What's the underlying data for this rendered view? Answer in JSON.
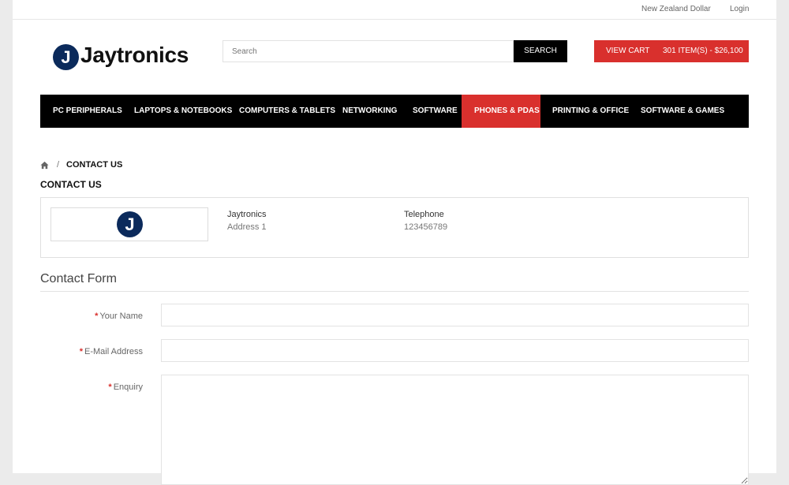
{
  "topbar": {
    "currency": "New Zealand Dollar",
    "login": "Login"
  },
  "header": {
    "logo_letter": "J",
    "logo_text": "Jaytronics",
    "search": {
      "placeholder": "Search",
      "button": "SEARCH"
    },
    "cart": {
      "label": "VIEW CART",
      "summary": "301 ITEM(S) - $26,100"
    }
  },
  "nav": {
    "items": [
      {
        "label": "PC PERIPHERALS"
      },
      {
        "label": "LAPTOPS & NOTEBOOKS"
      },
      {
        "label": "COMPUTERS & TABLETS"
      },
      {
        "label": "NETWORKING"
      },
      {
        "label": "SOFTWARE"
      },
      {
        "label": "PHONES & PDAS",
        "active": true
      },
      {
        "label": "PRINTING & OFFICE"
      },
      {
        "label": "SOFTWARE & GAMES"
      }
    ]
  },
  "breadcrumb": {
    "home_icon": "home-icon",
    "separator": "/",
    "current": "CONTACT US"
  },
  "page_title": "CONTACT US",
  "store_info": {
    "logo_letter": "J",
    "name": "Jaytronics",
    "address": "Address 1",
    "telephone_label": "Telephone",
    "telephone": "123456789"
  },
  "form": {
    "title": "Contact Form",
    "required_marker": "*",
    "fields": {
      "name": {
        "label": "Your Name",
        "value": ""
      },
      "email": {
        "label": "E-Mail Address",
        "value": ""
      },
      "enquiry": {
        "label": "Enquiry",
        "value": ""
      }
    }
  },
  "colors": {
    "accent": "#d9302d",
    "nav_bg": "#000000",
    "logo_navy": "#0b2a5b",
    "page_bg": "#ebebeb"
  }
}
